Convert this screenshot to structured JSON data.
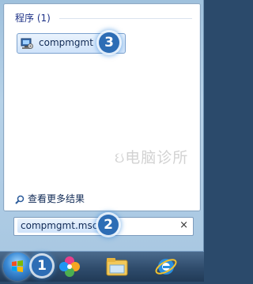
{
  "start_menu": {
    "programs_header": "程序 (1)",
    "results": [
      {
        "label": "compmgmt",
        "icon": "computer-management-icon"
      }
    ],
    "see_more_label": "查看更多结果",
    "search": {
      "value": "compmgmt.msc",
      "clear_label": "×"
    },
    "watermark": "电脑诊所"
  },
  "step_badges": {
    "search_box": "2",
    "result_item": "3",
    "start_button": "1"
  },
  "taskbar": {
    "icons": [
      "start-orb-icon",
      "pinwheel-app-icon",
      "file-explorer-icon",
      "internet-explorer-icon"
    ]
  },
  "colors": {
    "accent": "#2d6db5",
    "header_text": "#1e3287"
  }
}
